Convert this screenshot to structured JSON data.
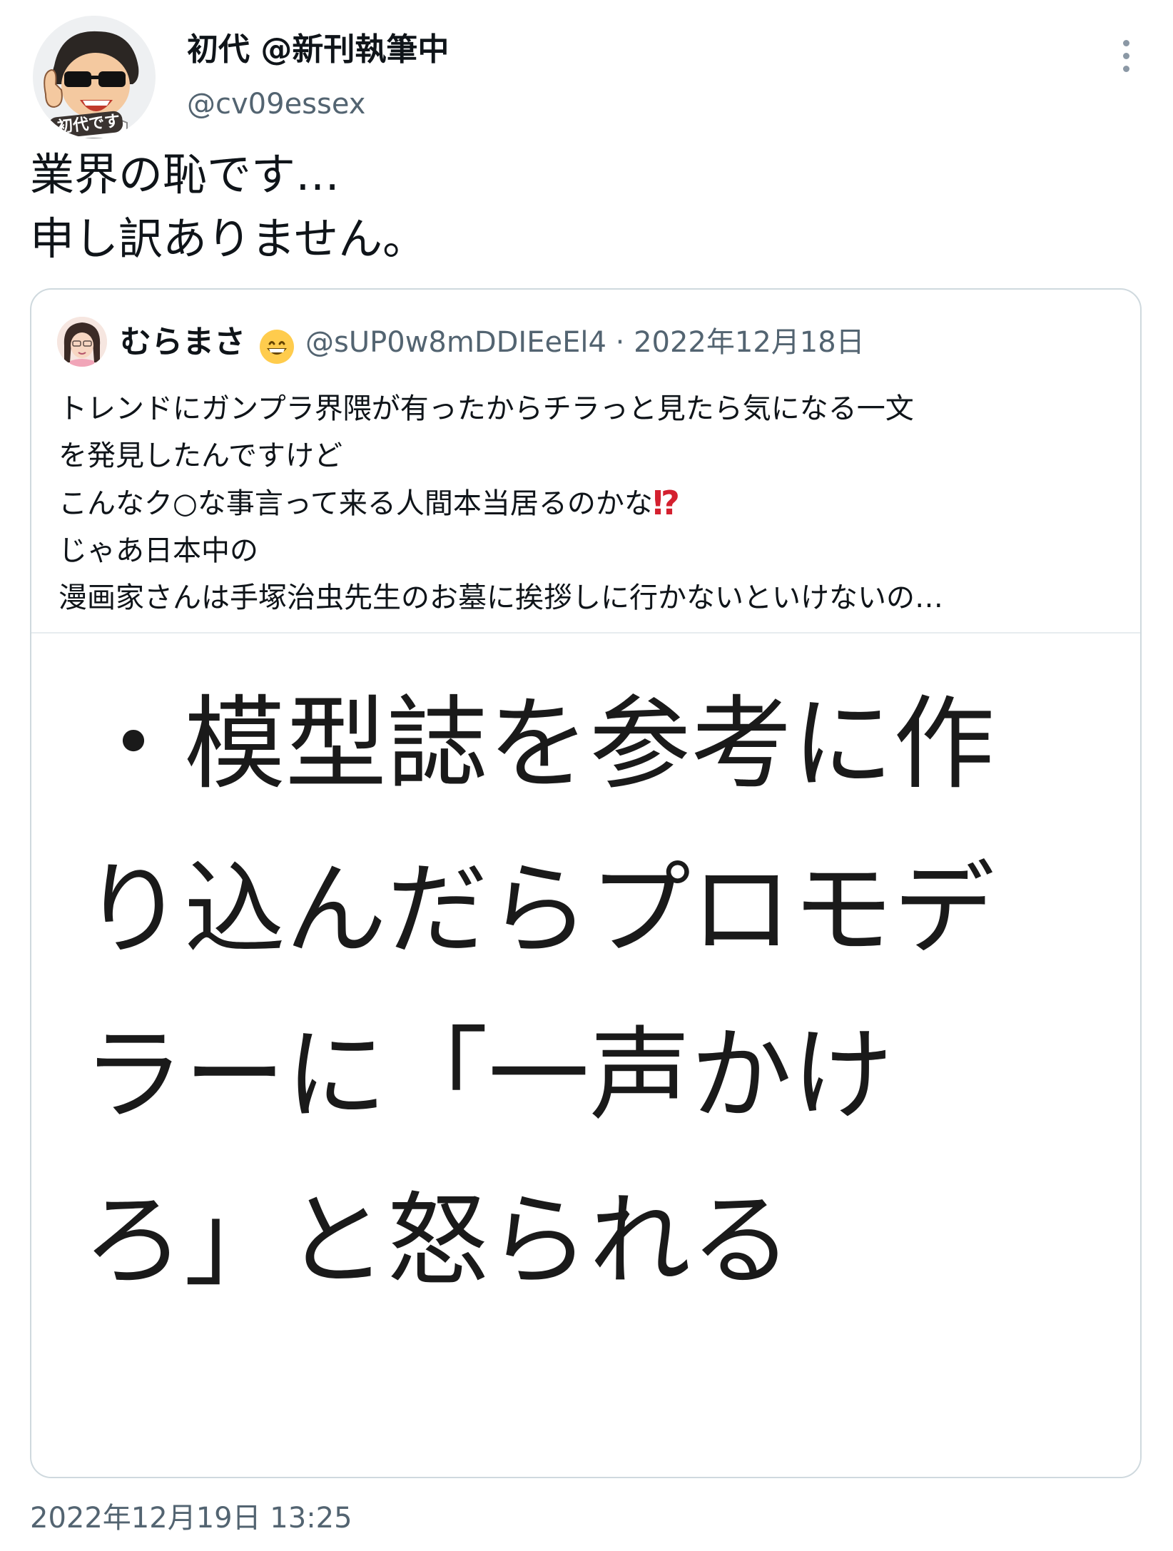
{
  "tweet": {
    "author": {
      "display_name": "初代 @新刊執筆中",
      "handle": "@cv09essex",
      "avatar_badge": "初代です"
    },
    "text_lines": [
      "業界の恥です…",
      "申し訳ありません。"
    ],
    "timestamp": "2022年12月19日 13:25"
  },
  "quote": {
    "author": {
      "display_name": "むらまさ",
      "emoji_icon": "grinning-face-icon",
      "handle_date": "@sUP0w8mDDIEeEl4 · 2022年12月18日"
    },
    "text_lines": [
      "トレンドにガンプラ界隈が有ったからチラっと見たら気になる一文",
      "を発見したんですけど",
      "こんなク○な事言って来る人間本当居るのかな",
      "じゃあ日本中の",
      "漫画家さんは手塚治虫先生のお墓に挨拶しに行かないといけないの…"
    ],
    "interrobang": "⁉",
    "image_text": "・模型誌を参考に作り込んだらプロモデラーに「一声かけろ」と怒られる"
  },
  "colors": {
    "text_primary": "#0f1419",
    "text_secondary": "#536471",
    "border": "#cfd9de",
    "accent_red": "#d4202f"
  }
}
